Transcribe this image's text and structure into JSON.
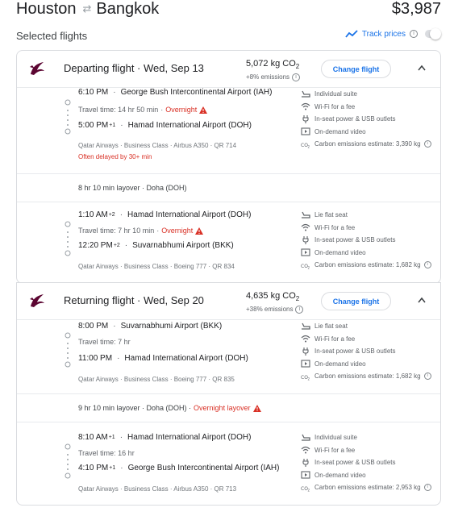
{
  "header": {
    "origin": "Houston",
    "destination": "Bangkok",
    "swap_icon": "swap-arrows-icon",
    "total_price": "$3,987"
  },
  "selected_title": "Selected flights",
  "track": {
    "label": "Track prices",
    "icon": "trend-line-icon"
  },
  "co2_label": "kg CO",
  "co2_subscript": "2",
  "colors": {
    "accent": "#1a73e8",
    "warning": "#d93025",
    "muted": "#5f6368",
    "border": "#dadce0"
  },
  "departing": {
    "title": "Departing flight · Wed, Sep 13",
    "co2_value": "5,072",
    "co2_change": "+8% emissions",
    "change_label": "Change flight",
    "leg1": {
      "dep_time": "6:10 PM",
      "dep_airport": "George Bush Intercontinental Airport (IAH)",
      "travel_time": "Travel time: 14 hr 50 min",
      "travel_note": "Overnight",
      "arr_time": "5:00 PM",
      "arr_offset": "+1",
      "arr_airport": "Hamad International Airport (DOH)",
      "meta": "Qatar Airways · Business Class · Airbus A350 · QR 714",
      "delay": "Often delayed by 30+ min",
      "amenities": [
        "Individual suite",
        "Wi-Fi for a fee",
        "In-seat power & USB outlets",
        "On-demand video",
        "Carbon emissions estimate: 3,390 kg"
      ]
    },
    "layover": {
      "text": "8 hr 10 min layover · Doha (DOH)",
      "note": ""
    },
    "leg2": {
      "dep_time": "1:10 AM",
      "dep_offset": "+2",
      "dep_airport": "Hamad International Airport (DOH)",
      "travel_time": "Travel time: 7 hr 10 min",
      "travel_note": "Overnight",
      "arr_time": "12:20 PM",
      "arr_offset": "+2",
      "arr_airport": "Suvarnabhumi Airport (BKK)",
      "meta": "Qatar Airways · Business Class · Boeing 777 · QR 834",
      "amenities": [
        "Lie flat seat",
        "Wi-Fi for a fee",
        "In-seat power & USB outlets",
        "On-demand video",
        "Carbon emissions estimate: 1,682 kg"
      ]
    }
  },
  "returning": {
    "title": "Returning flight · Wed, Sep 20",
    "co2_value": "4,635",
    "co2_change": "+38% emissions",
    "change_label": "Change flight",
    "leg1": {
      "dep_time": "8:00 PM",
      "dep_airport": "Suvarnabhumi Airport (BKK)",
      "travel_time": "Travel time: 7 hr",
      "arr_time": "11:00 PM",
      "arr_airport": "Hamad International Airport (DOH)",
      "meta": "Qatar Airways · Business Class · Boeing 777 · QR 835",
      "amenities": [
        "Lie flat seat",
        "Wi-Fi for a fee",
        "In-seat power & USB outlets",
        "On-demand video",
        "Carbon emissions estimate: 1,682 kg"
      ]
    },
    "layover": {
      "text": "9 hr 10 min layover · Doha (DOH) ·",
      "note": "Overnight layover"
    },
    "leg2": {
      "dep_time": "8:10 AM",
      "dep_offset": "+1",
      "dep_airport": "Hamad International Airport (DOH)",
      "travel_time": "Travel time: 16 hr",
      "arr_time": "4:10 PM",
      "arr_offset": "+1",
      "arr_airport": "George Bush Intercontinental Airport (IAH)",
      "meta": "Qatar Airways · Business Class · Airbus A350 · QR 713",
      "amenities": [
        "Individual suite",
        "Wi-Fi for a fee",
        "In-seat power & USB outlets",
        "On-demand video",
        "Carbon emissions estimate: 2,953 kg"
      ]
    }
  }
}
